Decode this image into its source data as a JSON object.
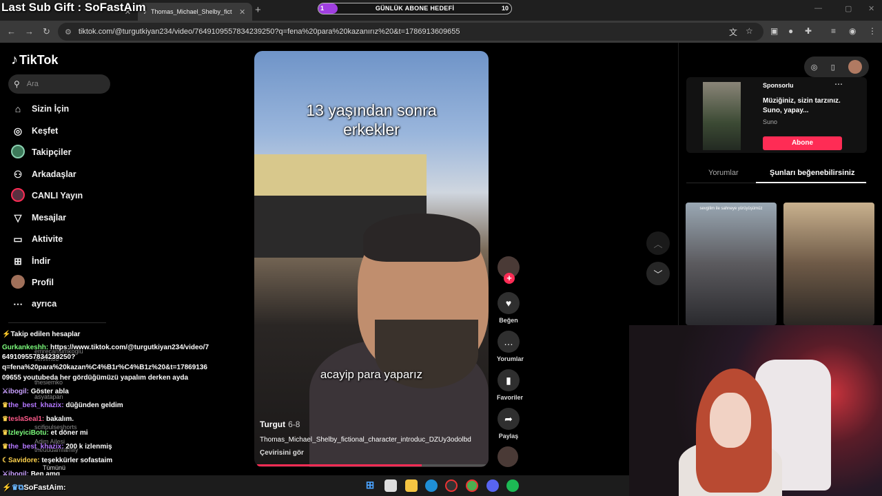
{
  "overlay": {
    "last_sub": "Last Sub Gift : SoFastAim",
    "goal_label": "GÜNLÜK ABONE HEDEFİ",
    "goal_current": "1",
    "goal_target": "10",
    "goal_progress": 0.1,
    "streamer_name": "SoFastAim:"
  },
  "browser": {
    "tab2_title": "Thomas_Michael_Shelby_fictional",
    "url": "tiktok.com/@turgutkiyan234/video/7649109557834239250?q=fena%20para%20kazanırız%20&t=1786913609655"
  },
  "sidebar": {
    "logo": "TikTok",
    "search_placeholder": "Ara",
    "items": [
      {
        "label": "Sizin İçin",
        "icon": "home-icon"
      },
      {
        "label": "Keşfet",
        "icon": "compass-icon"
      },
      {
        "label": "Takipçiler",
        "icon": "avatar-icon"
      },
      {
        "label": "Arkadaşlar",
        "icon": "friends-icon"
      },
      {
        "label": "CANLI Yayın",
        "icon": "live-icon"
      },
      {
        "label": "Mesajlar",
        "icon": "send-icon"
      },
      {
        "label": "Aktivite",
        "icon": "inbox-icon"
      },
      {
        "label": "İndir",
        "icon": "download-icon"
      },
      {
        "label": "Profil",
        "icon": "avatar-icon"
      },
      {
        "label": "ayrıca",
        "icon": "more-icon"
      }
    ],
    "following_header": "Takip edilen hesaplar"
  },
  "chat": {
    "messages": [
      {
        "user": "Gurkankeshh:",
        "text": "https://www.tiktok.com/@turgutkiyan234/video/7",
        "color": "#7cfc7c"
      },
      {
        "user": "",
        "text": "649109557834239250?",
        "color": ""
      },
      {
        "user": "",
        "text": "q=fena%20para%20kazan%C4%B1r%C4%B1z%20&t=17869136",
        "color": ""
      },
      {
        "user": "",
        "text": "09655 youtubeda her gördüğümüzü yapalım derken ayda",
        "color": ""
      },
      {
        "user": "ibogil:",
        "text": "Göster abla",
        "color": "#c9a0ff"
      },
      {
        "user": "the_best_khazix:",
        "text": "düğünden geldim",
        "color": "#b478ff"
      },
      {
        "user": "teslaSeal1:",
        "text": "bakalım.",
        "color": "#ff5a8a"
      },
      {
        "user": "IzleyiciBotu:",
        "text": "et döner mi",
        "color": "#7cfc7c"
      },
      {
        "user": "the_best_khazix:",
        "text": "200 k izlenmiş",
        "color": "#b478ff"
      },
      {
        "user": "Savidore:",
        "text": "teşekkürler sofastaim",
        "color": "#ffd34d"
      },
      {
        "user": "ibogil:",
        "text": "Ben amq",
        "color": "#c9a0ff"
      }
    ],
    "ghost": [
      "emrecansimkoglu",
      "selvimoo",
      "thesiemko",
      "asyatapan",
      "scifipulseshorts",
      "Adim Ailesi",
      "theuudamfamily",
      "Tümünü"
    ]
  },
  "video": {
    "title_line1": "13 yaşından sonra",
    "title_line2": "erkekler",
    "subtitle": "acayip para yaparız",
    "author": "Turgut",
    "date": "6-8",
    "description": "Thomas_Michael_Shelby_fictional_character_introduc_DZUy3odolbd",
    "translate": "Çevirisini gör",
    "progress": 0.72
  },
  "actions": {
    "like": "Beğen",
    "comments": "Yorumlar",
    "favorites": "Favoriler",
    "share": "Paylaş"
  },
  "right_panel": {
    "sponsored": "Sponsorlu",
    "ad_title": "Müziğiniz, sizin tarzınız. Suno, yapay...",
    "ad_source": "Suno",
    "ad_button": "Abone",
    "tab_comments": "Yorumlar",
    "tab_suggested": "Şunları beğenebilirsiniz",
    "thumb1_caption": "sevgilim ile sahneye yürüyüşümüz"
  },
  "colors": {
    "accent": "#fe2c55",
    "goal_fill": "#a03fe0"
  }
}
